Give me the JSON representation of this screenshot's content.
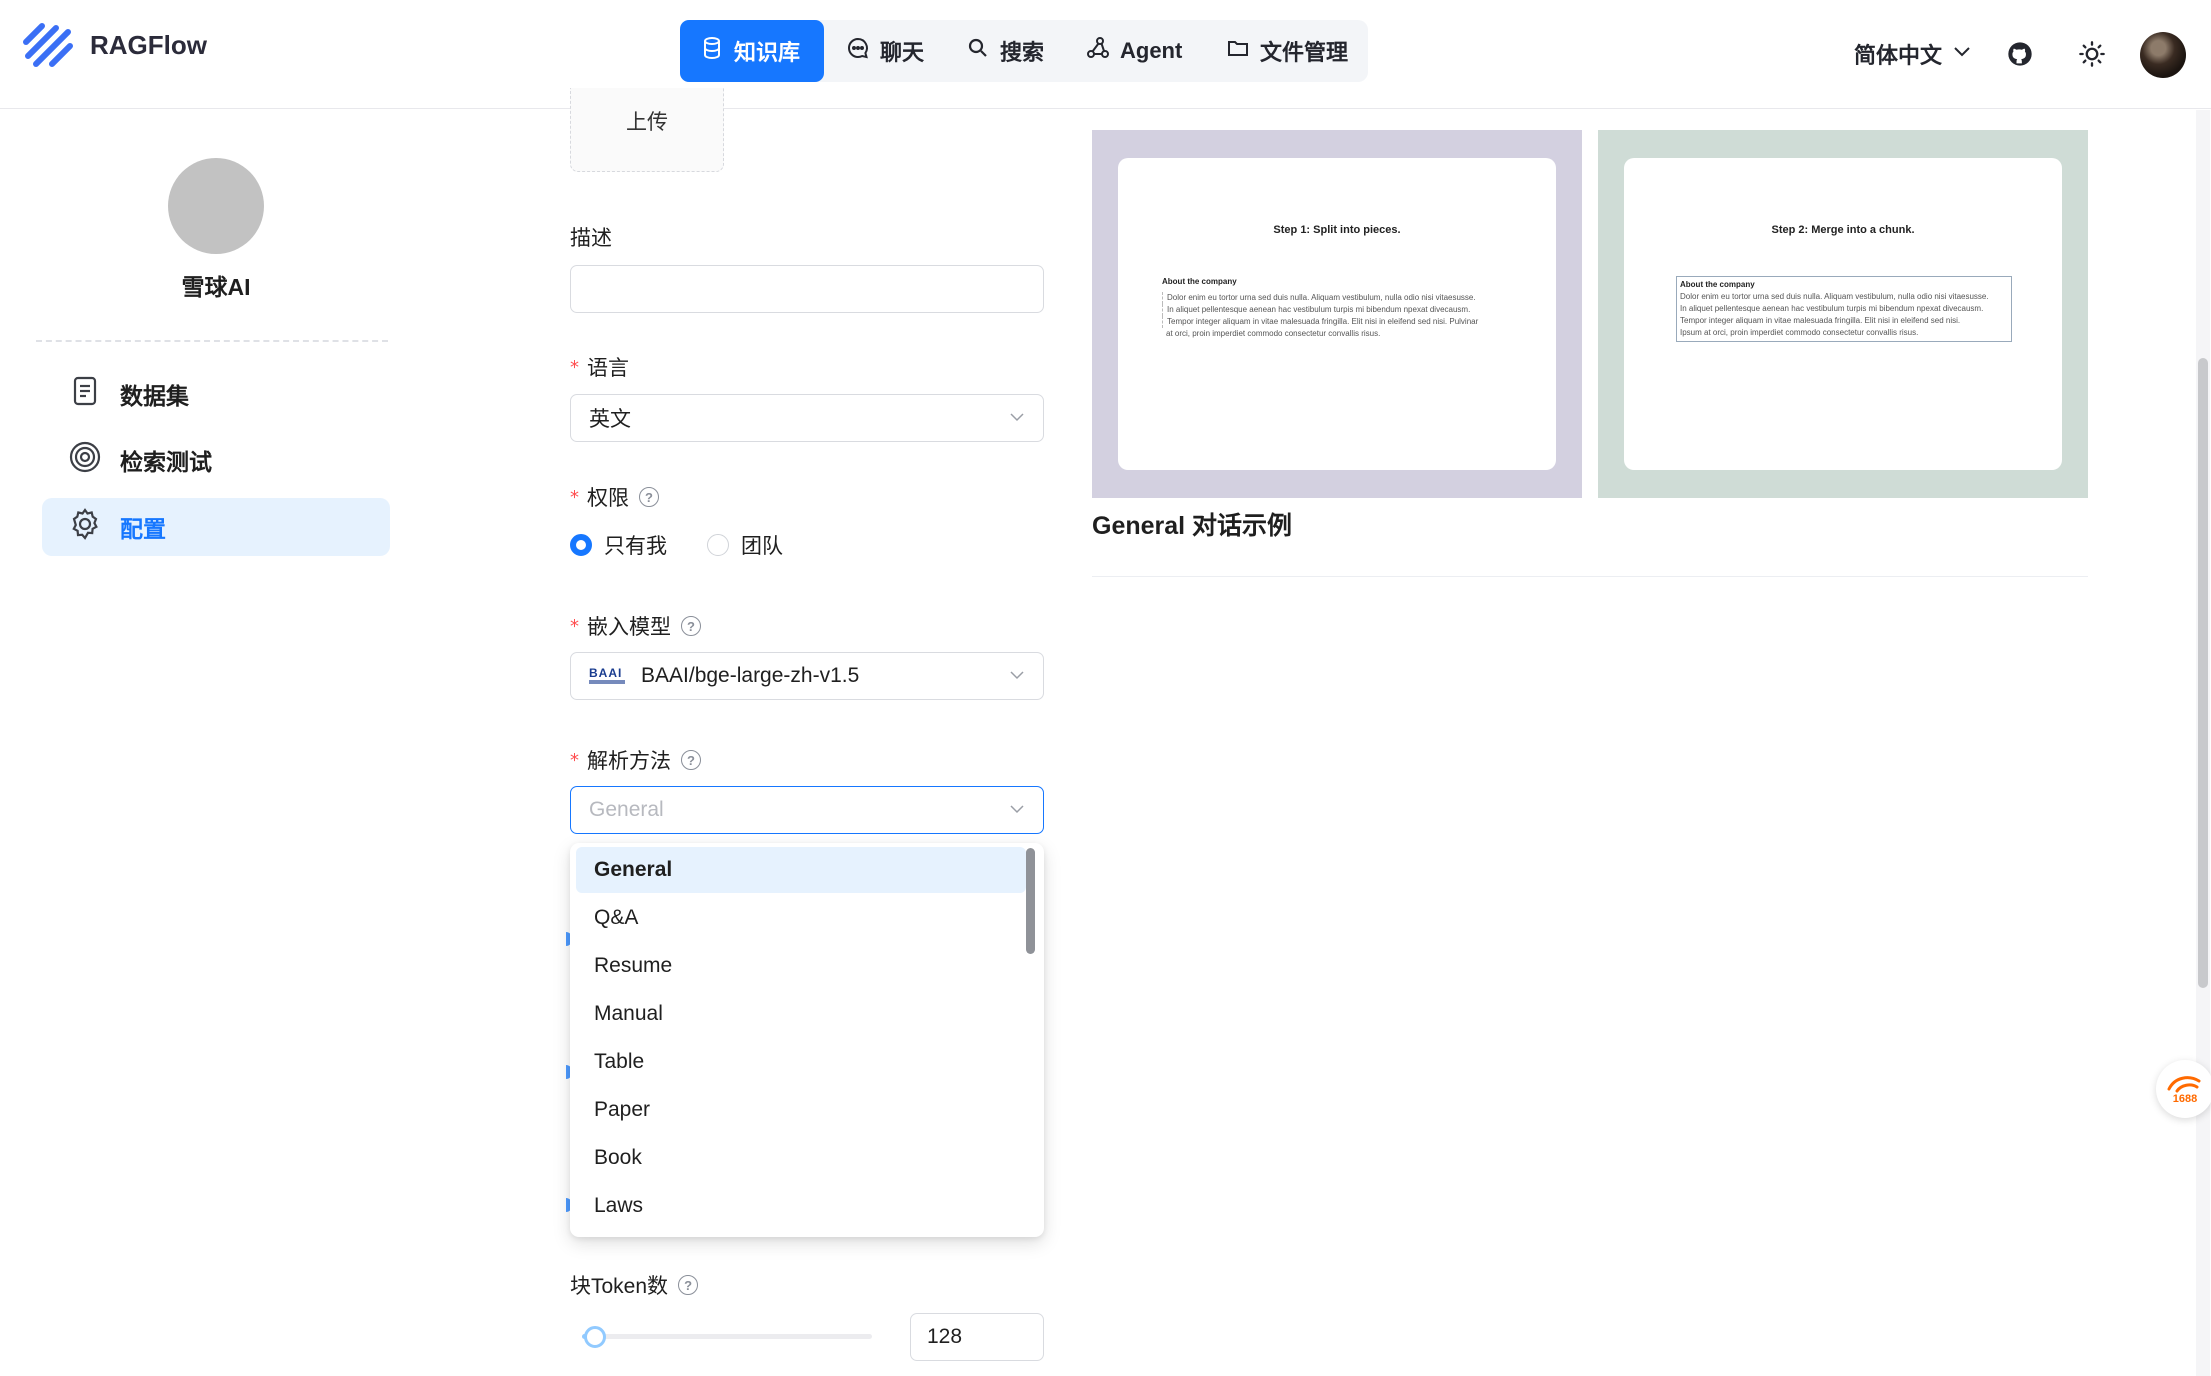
{
  "app": {
    "name": "RAGFlow"
  },
  "nav": {
    "items": [
      {
        "label": "知识库",
        "icon": "database-icon",
        "active": true
      },
      {
        "label": "聊天",
        "icon": "chat-icon",
        "active": false
      },
      {
        "label": "搜索",
        "icon": "search-icon",
        "active": false
      },
      {
        "label": "Agent",
        "icon": "agent-icon",
        "active": false
      },
      {
        "label": "文件管理",
        "icon": "folder-icon",
        "active": false
      }
    ],
    "language": "简体中文"
  },
  "sidebar": {
    "kb_name": "雪球AI",
    "items": [
      {
        "label": "数据集",
        "icon": "document-icon",
        "active": false
      },
      {
        "label": "检索测试",
        "icon": "target-icon",
        "active": false
      },
      {
        "label": "配置",
        "icon": "gear-icon",
        "active": true
      }
    ]
  },
  "form": {
    "upload_label": "上传",
    "description": {
      "label": "描述",
      "value": ""
    },
    "language": {
      "label": "语言",
      "value": "英文"
    },
    "permission": {
      "label": "权限",
      "options": [
        "只有我",
        "团队"
      ],
      "selected": "只有我"
    },
    "embedding": {
      "label": "嵌入模型",
      "value": "BAAI/bge-large-zh-v1.5",
      "logo_text": "BAAI"
    },
    "parser": {
      "label": "解析方法",
      "placeholder": "General"
    },
    "chunk_tokens": {
      "label": "块Token数",
      "value": "128"
    }
  },
  "dropdown": {
    "options": [
      "General",
      "Q&A",
      "Resume",
      "Manual",
      "Table",
      "Paper",
      "Book",
      "Laws"
    ],
    "selected": "General"
  },
  "preview": {
    "step1": {
      "title": "Step 1: Split into pieces.",
      "heading": "About the company",
      "lines": [
        "Dolor enim eu tortor urna sed duis nulla. Aliquam vestibulum, nulla odio nisi vitaesusse.",
        "In aliquet pellentesque aenean hac vestibulum turpis mi bibendum npexat divecausm.",
        "Tempor integer aliquam in vitae malesuada fringilla. Elit nisi in eleifend sed nisi. Pulvinar",
        "at orci, proin imperdiet commodo consectetur convallis risus."
      ]
    },
    "step2": {
      "title": "Step 2: Merge into a chunk.",
      "heading": "About the company",
      "lines": [
        "Dolor enim eu tortor urna sed duis nulla. Aliquam vestibulum, nulla odio nisi vitaesusse.",
        "In aliquet pellentesque aenean hac vestibulum turpis mi bibendum npexat divecausm.",
        "Tempor integer aliquam in vitae malesuada fringilla. Elit nisi in eleifend sed nisi.",
        "Ipsum at orci, proin imperdiet commodo consectetur convallis risus."
      ]
    },
    "example_title": "General 对话示例"
  },
  "badge": {
    "text": "1688"
  },
  "colors": {
    "accent": "#1677ff",
    "step1_bg": "#d3d0e0",
    "step2_bg": "#cfdcd6"
  }
}
